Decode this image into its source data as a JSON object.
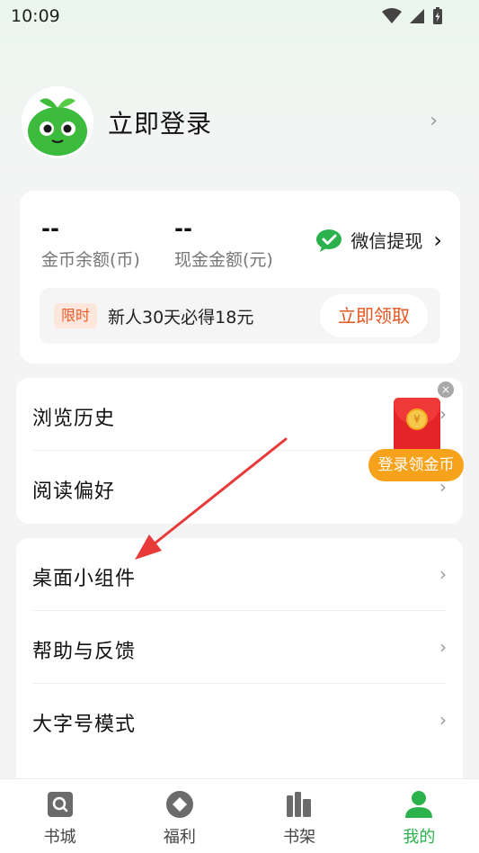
{
  "status_bar": {
    "time": "10:09"
  },
  "profile": {
    "title": "立即登录"
  },
  "wallet": {
    "coin": {
      "value": "--",
      "label": "金币余额(币)"
    },
    "cash": {
      "value": "--",
      "label": "现金金额(元)"
    },
    "wechat_label": "微信提现",
    "promo": {
      "tag": "限时",
      "text": "新人30天必得18元",
      "button": "立即领取"
    }
  },
  "menu_group_1": [
    {
      "label": "浏览历史"
    },
    {
      "label": "阅读偏好"
    }
  ],
  "menu_group_2": [
    {
      "label": "桌面小组件"
    },
    {
      "label": "帮助与反馈"
    },
    {
      "label": "大字号模式"
    }
  ],
  "float_promo": {
    "label": "登录领金币",
    "coin_symbol": "¥"
  },
  "bottom_nav": [
    {
      "label": "书城",
      "icon": "bookstore-icon"
    },
    {
      "label": "福利",
      "icon": "welfare-icon"
    },
    {
      "label": "书架",
      "icon": "bookshelf-icon"
    },
    {
      "label": "我的",
      "icon": "profile-icon",
      "active": true
    }
  ],
  "colors": {
    "brand_green": "#2bb24c",
    "promo_orange": "#e8551f",
    "arrow_red": "#e83a3a"
  }
}
